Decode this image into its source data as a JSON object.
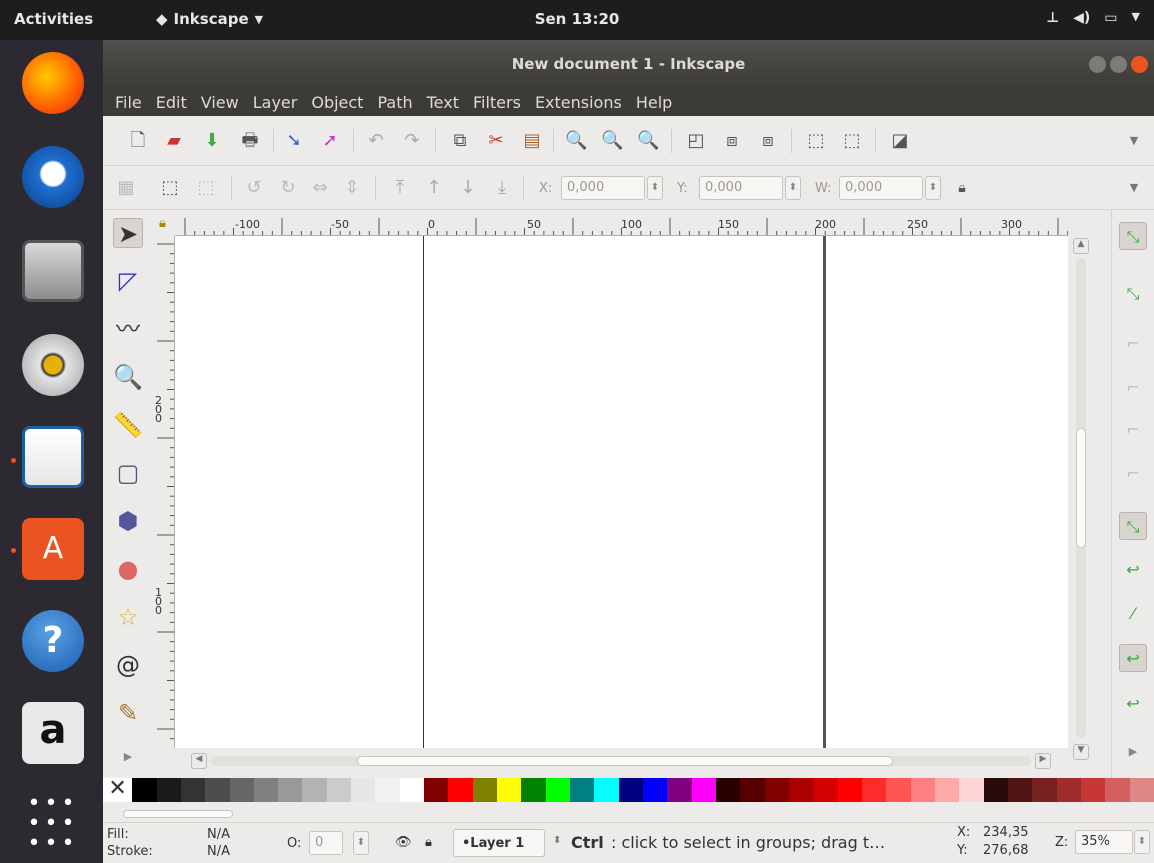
{
  "topbar": {
    "activities": "Activities",
    "app_name": "Inkscape",
    "clock": "Sen 13:20"
  },
  "window": {
    "title": "New document 1 - Inkscape"
  },
  "menu": [
    "File",
    "Edit",
    "View",
    "Layer",
    "Object",
    "Path",
    "Text",
    "Filters",
    "Extensions",
    "Help"
  ],
  "toolbar2": {
    "x_label": "X:",
    "x_value": "0,000",
    "y_label": "Y:",
    "y_value": "0,000",
    "w_label": "W:",
    "w_value": "0,000"
  },
  "ruler": {
    "h_labels": [
      "-100",
      "-50",
      "0",
      "50",
      "100",
      "150",
      "200",
      "250",
      "300"
    ],
    "v_labels": [
      "200",
      "100"
    ]
  },
  "status": {
    "fill_label": "Fill:",
    "stroke_label": "Stroke:",
    "fill_value": "N/A",
    "stroke_value": "N/A",
    "opacity_label": "O:",
    "opacity_value": "0",
    "layer": "•Layer 1",
    "message_key": "Ctrl",
    "message": ": click to select in groups; drag t…",
    "x_label": "X:",
    "x_value": "234,35",
    "y_label": "Y:",
    "y_value": "276,68",
    "zoom_label": "Z:",
    "zoom_value": "35%"
  },
  "palette": [
    "#000000",
    "#1a1a1a",
    "#333333",
    "#4d4d4d",
    "#666666",
    "#808080",
    "#999999",
    "#b3b3b3",
    "#cccccc",
    "#e6e6e6",
    "#f2f2f2",
    "#ffffff",
    "#800000",
    "#ff0000",
    "#808000",
    "#ffff00",
    "#008000",
    "#00ff00",
    "#008080",
    "#00ffff",
    "#000080",
    "#0000ff",
    "#800080",
    "#ff00ff",
    "#2b0000",
    "#550000",
    "#800000",
    "#aa0000",
    "#d40000",
    "#ff0000",
    "#ff2a2a",
    "#ff5555",
    "#ff8080",
    "#ffaaaa",
    "#ffd5d5",
    "#280b0b",
    "#501616",
    "#782121",
    "#a02c2c",
    "#c83737",
    "#d35f5f",
    "#de8787"
  ],
  "colors": {
    "accent": "#e95420",
    "panel": "#edebe9",
    "titlebar": "#3c3b37"
  }
}
